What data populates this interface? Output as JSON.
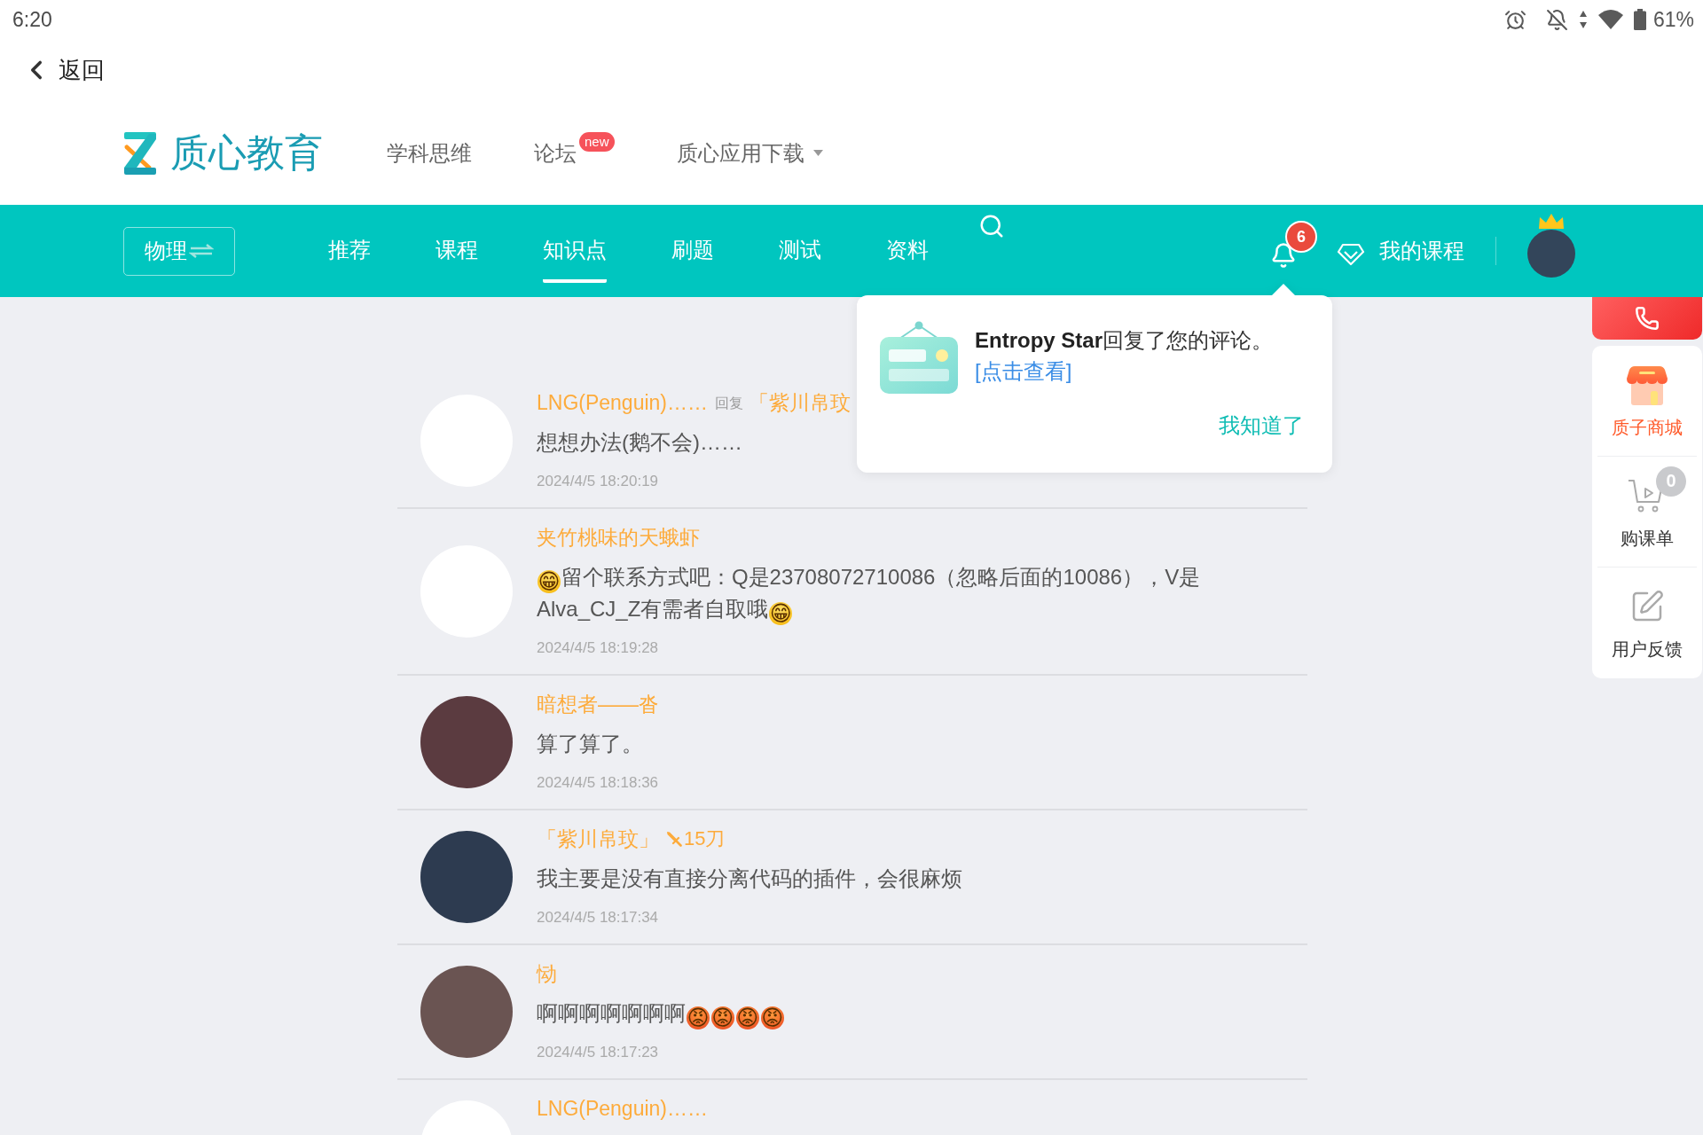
{
  "status_bar": {
    "time": "6:20",
    "battery": "61%"
  },
  "back": {
    "label": "返回"
  },
  "header": {
    "logo": "质心教育",
    "links": [
      {
        "label": "学科思维",
        "dropdown": false
      },
      {
        "label": "论坛",
        "badge": "new",
        "dropdown": false
      },
      {
        "label": "质心应用下载",
        "dropdown": true
      }
    ]
  },
  "nav": {
    "subject": "物理",
    "tabs": [
      {
        "label": "推荐",
        "selected": false
      },
      {
        "label": "课程",
        "selected": false
      },
      {
        "label": "知识点",
        "selected": true
      },
      {
        "label": "刷题",
        "selected": false
      },
      {
        "label": "测试",
        "selected": false
      },
      {
        "label": "资料",
        "selected": false
      }
    ],
    "notifications": "6",
    "my_courses": "我的课程",
    "avatar": {
      "color": "#33455a"
    }
  },
  "comments": [
    {
      "name": "LNG(Penguin)……",
      "reply_label": "回复",
      "reply_to": "「紫川帛玟",
      "text": "想想办法(鹅不会)……",
      "time": "2024/4/5 18:20:19",
      "avatar": {
        "color": "#ffffff"
      }
    },
    {
      "name": "夹竹桃味的天蛾虾",
      "text": "😁留个联系方式吧：Q是23708072710086（忽略后面的10086），V是Alva_CJ_Z有需者自取哦😁",
      "time": "2024/4/5 18:19:28",
      "avatar": {
        "color": "#ffffff"
      }
    },
    {
      "name": "暗想者——沓",
      "text": "算了算了。",
      "time": "2024/4/5 18:18:36",
      "avatar": {
        "color": "#5b3b40"
      }
    },
    {
      "name": "「紫川帛玟」",
      "badge": "15刀",
      "text": "我主要是没有直接分离代码的插件，会很麻烦",
      "time": "2024/4/5 18:17:34",
      "avatar": {
        "color": "#2d3b50"
      }
    },
    {
      "name": "恸",
      "text": "啊啊啊啊啊啊啊😡😡😡😡",
      "time": "2024/4/5 18:17:23",
      "avatar": {
        "color": "#6a5452"
      }
    },
    {
      "name": "LNG(Penguin)……",
      "avatar": {
        "color": "#ffffff"
      }
    }
  ],
  "notification_popup": {
    "message": "**Entropy Star**回复了您的评论。",
    "link": "[点击查看]",
    "dismiss": "我知道了"
  },
  "side_panel": {
    "items": [
      {
        "kind": "store",
        "label": "质子商城"
      },
      {
        "kind": "cart",
        "label": "购课单",
        "badge": "0"
      },
      {
        "kind": "feedback",
        "label": "用户反馈"
      }
    ]
  }
}
